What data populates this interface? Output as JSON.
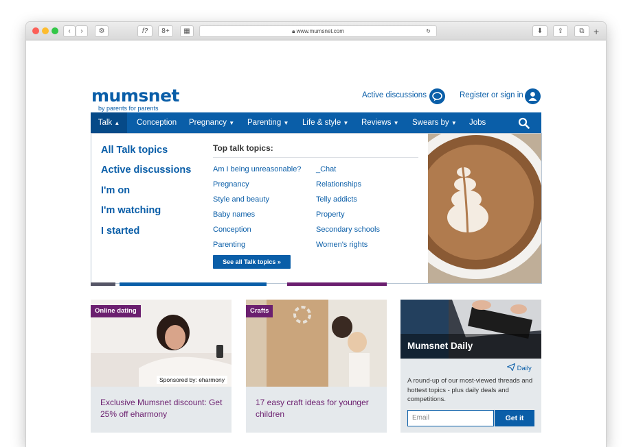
{
  "browser": {
    "url": "www.mumsnet.com",
    "reader_label": "f?",
    "toolbar_dark_label": "8+"
  },
  "header": {
    "logo": "mumsnet",
    "tagline": "by parents for parents",
    "active_discussions": "Active discussions",
    "register": "Register or sign in"
  },
  "nav": {
    "items": [
      "Talk",
      "Conception",
      "Pregnancy",
      "Parenting",
      "Life & style",
      "Reviews",
      "Swears by",
      "Jobs"
    ]
  },
  "mega": {
    "left_links": [
      "All Talk topics",
      "Active discussions",
      "I'm on",
      "I'm watching",
      "I started"
    ],
    "topics_title": "Top talk topics:",
    "topics_col1": [
      "Am I being unreasonable?",
      "Pregnancy",
      "Style and beauty",
      "Baby names",
      "Conception",
      "Parenting"
    ],
    "topics_col2": [
      "_Chat",
      "Relationships",
      "Telly addicts",
      "Property",
      "Secondary schools",
      "Women's rights"
    ],
    "see_all": "See all Talk topics »"
  },
  "cards": [
    {
      "tag": "Online dating",
      "sponsor": "Sponsored by: eharmony",
      "title": "Exclusive Mumsnet discount: Get 25% off eharmony"
    },
    {
      "tag": "Crafts",
      "title": "17 easy craft ideas for younger children"
    }
  ],
  "daily": {
    "name": "Mumsnet Daily",
    "tag": "Daily",
    "description": "A round-up of our most-viewed threads and hottest topics - plus daily deals and competitions.",
    "email_placeholder": "Email",
    "button": "Get it"
  },
  "colors": {
    "brand_blue": "#0a5ea8",
    "purple": "#6b1f6f"
  }
}
